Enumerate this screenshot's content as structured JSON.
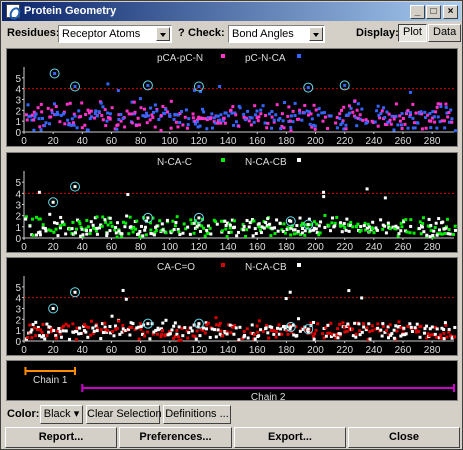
{
  "window": {
    "title": "Protein Geometry"
  },
  "toolbar": {
    "residues_label": "Residues:",
    "residues_value": "Receptor Atoms",
    "help_glyph": "?",
    "check_label": "Check:",
    "check_value": "Bond Angles",
    "display_label": "Display:",
    "display_options": [
      "Plot",
      "Data"
    ],
    "display_selected": "Plot"
  },
  "plots": [
    {
      "legend": [
        {
          "label": "pCA-pC-N",
          "color": "#ff33cc"
        },
        {
          "label": "pC-N-CA",
          "color": "#3366ff"
        }
      ]
    },
    {
      "legend": [
        {
          "label": "N-CA-C",
          "color": "#00ee00"
        },
        {
          "label": "N-CA-CB",
          "color": "#ffffff"
        }
      ]
    },
    {
      "legend": [
        {
          "label": "CA-C=O",
          "color": "#dd0000"
        },
        {
          "label": "N-CA-CB",
          "color": "#ffffff"
        }
      ]
    }
  ],
  "chart_data": {
    "type": "scatter",
    "xlim": [
      0,
      295
    ],
    "ylim": [
      0,
      6
    ],
    "x_ticks": [
      0,
      20,
      40,
      60,
      80,
      100,
      120,
      140,
      160,
      180,
      200,
      220,
      240,
      260,
      280
    ],
    "y_ticks": [
      0,
      1,
      2,
      3,
      4,
      5
    ],
    "threshold": 4,
    "highlight_color": "#66ddee",
    "circled": [
      {
        "x": [
          21,
          35,
          85,
          120,
          195,
          220
        ],
        "y": [
          5.4,
          4.2,
          4.3,
          4.2,
          4.1,
          4.3
        ]
      },
      {
        "x": [
          20,
          35,
          85,
          120,
          183,
          195
        ],
        "y": [
          3.2,
          4.6,
          1.8,
          1.8,
          1.5,
          1.2
        ]
      },
      {
        "x": [
          20,
          35,
          85,
          120,
          183,
          195
        ],
        "y": [
          3.0,
          4.5,
          1.6,
          1.6,
          1.3,
          1.1
        ]
      }
    ]
  },
  "chains": [
    {
      "label": "Chain 1",
      "start": 1,
      "end": 35,
      "color": "#ff8c00"
    },
    {
      "label": "Chain 2",
      "start": 40,
      "end": 295,
      "color": "#cc00cc"
    }
  ],
  "controls": {
    "color_label": "Color:",
    "color_value": "Black",
    "clear_selection": "Clear Selection",
    "definitions": "Definitions ..."
  },
  "footer": {
    "report": "Report...",
    "preferences": "Preferences...",
    "export": "Export...",
    "close": "Close"
  }
}
